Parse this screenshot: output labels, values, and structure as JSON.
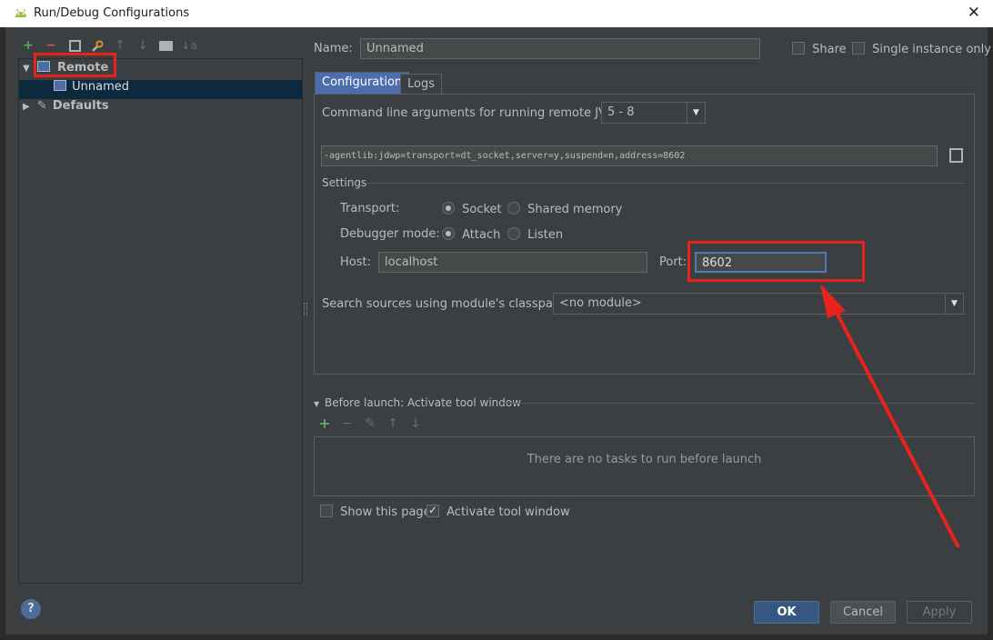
{
  "window": {
    "title": "Run/Debug Configurations",
    "close_glyph": "✕"
  },
  "toolbar": {
    "icons": [
      "add-icon",
      "remove-icon",
      "copy-icon",
      "wrench-icon",
      "move-up-icon",
      "move-down-icon",
      "folder-icon",
      "sort-icon"
    ]
  },
  "tree": {
    "remote_label": "Remote",
    "unnamed_label": "Unnamed",
    "defaults_label": "Defaults"
  },
  "form": {
    "name_label": "Name:",
    "name_value": "Unnamed",
    "share_label": "Share",
    "single_instance_label": "Single instance only",
    "tabs": [
      "Configuration",
      "Logs"
    ],
    "jvm_args_label": "Command line arguments for running remote JVM",
    "jvm_version": "5 - 8",
    "agent_string": "-agentlib:jdwp=transport=dt_socket,server=y,suspend=n,address=8602",
    "settings_label": "Settings",
    "transport_label": "Transport:",
    "transport_socket": "Socket",
    "transport_shared": "Shared memory",
    "debugger_mode_label": "Debugger mode:",
    "mode_attach": "Attach",
    "mode_listen": "Listen",
    "host_label": "Host:",
    "host_value": "localhost",
    "port_label": "Port:",
    "port_value": "8602",
    "classpath_label": "Search sources using module's classpath:",
    "classpath_value": "<no module>"
  },
  "before_launch": {
    "title": "Before launch: Activate tool window",
    "empty_text": "There are no tasks to run before launch"
  },
  "options": {
    "show_page": "Show this page",
    "activate_tool": "Activate tool window"
  },
  "buttons": {
    "ok": "OK",
    "cancel": "Cancel",
    "apply": "Apply"
  },
  "help_glyph": "?",
  "colors": {
    "background": "#3c3f41",
    "annotation": "#e8231b",
    "primary": "#365880"
  }
}
